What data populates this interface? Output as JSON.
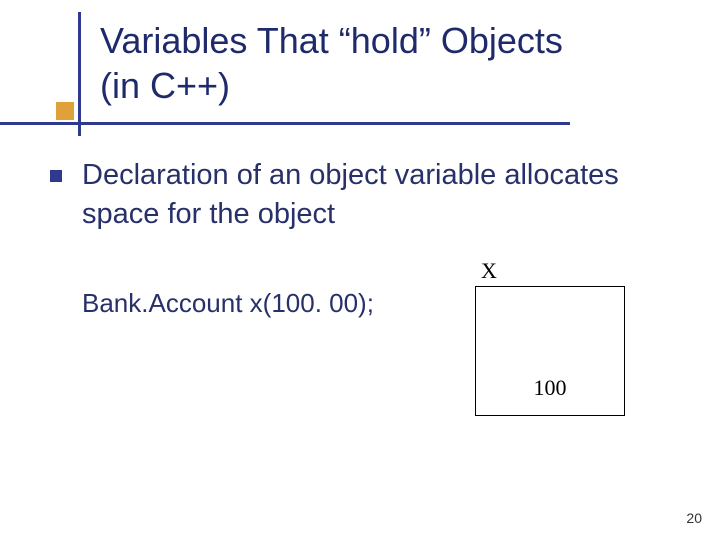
{
  "title": {
    "line1": "Variables That “hold” Objects",
    "line2": "(in C++)"
  },
  "bullet": "Declaration of an object variable allocates space for the object",
  "code": "Bank.Account x(100. 00);",
  "diagram": {
    "label": "X",
    "value": "100"
  },
  "page_number": "20"
}
